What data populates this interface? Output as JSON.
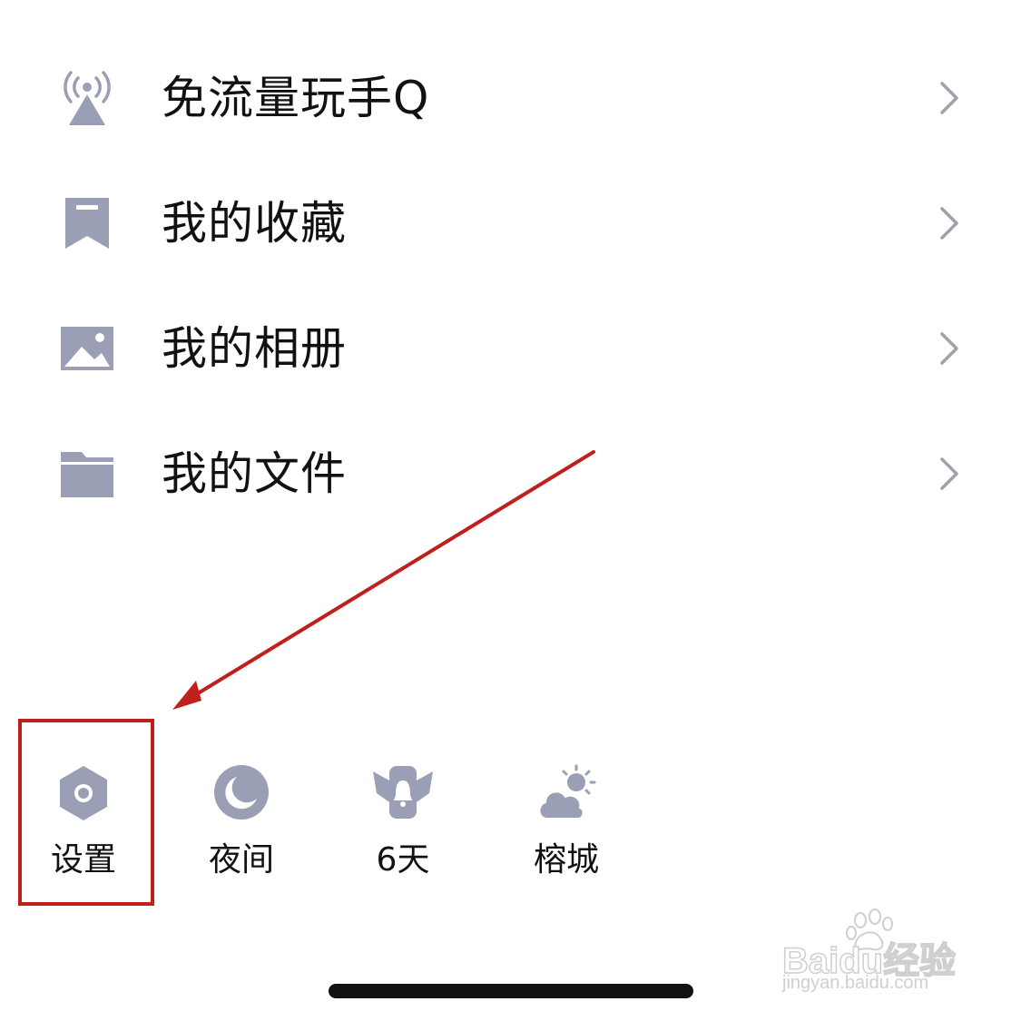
{
  "menu": {
    "items": [
      {
        "label": "免流量玩手Q",
        "icon": "free-data-antenna-icon"
      },
      {
        "label": "我的收藏",
        "icon": "bookmark-icon"
      },
      {
        "label": "我的相册",
        "icon": "photo-album-icon"
      },
      {
        "label": "我的文件",
        "icon": "folder-icon"
      }
    ]
  },
  "toolbar": {
    "items": [
      {
        "label": "设置",
        "icon": "settings-gear-icon"
      },
      {
        "label": "夜间",
        "icon": "night-mode-moon-icon"
      },
      {
        "label": "6天",
        "icon": "checkin-angel-icon"
      },
      {
        "label": "榕城",
        "icon": "weather-cloud-sun-icon"
      }
    ]
  },
  "watermark": {
    "brand": "Baidu经验",
    "url": "jingyan.baidu.com"
  },
  "colors": {
    "icon": "#9a9fb5",
    "text": "#111111",
    "chevron": "#a0a0a8",
    "annotation": "#c0201c"
  }
}
